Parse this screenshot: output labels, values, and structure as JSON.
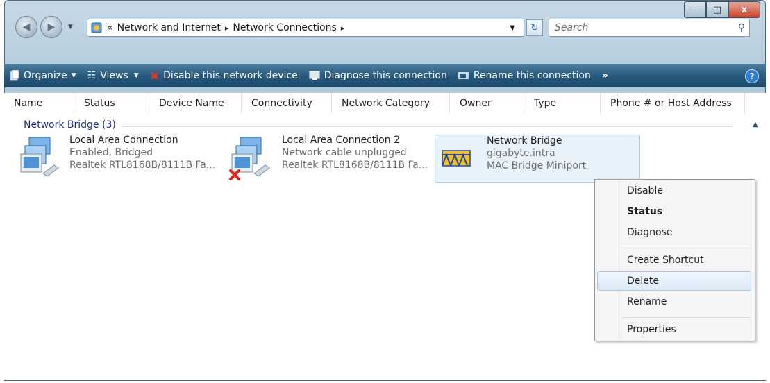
{
  "window": {
    "controls": {
      "minimize": "–",
      "maximize": "□",
      "close": "x"
    }
  },
  "nav": {
    "breadcrumb_prefix": "«",
    "crumbs": [
      "Network and Internet",
      "Network Connections"
    ],
    "separator": "▸",
    "search_placeholder": "Search"
  },
  "toolbar": {
    "items": [
      {
        "label": "Organize",
        "has_dropdown": true
      },
      {
        "label": "Views",
        "has_dropdown": true
      },
      {
        "label": "Disable this network device"
      },
      {
        "label": "Diagnose this connection"
      },
      {
        "label": "Rename this connection"
      }
    ],
    "more": "»",
    "help": "?"
  },
  "columns": [
    "Name",
    "Status",
    "Device Name",
    "Connectivity",
    "Network Category",
    "Owner",
    "Type",
    "Phone # or Host Address"
  ],
  "group": {
    "label": "Network Bridge (3)"
  },
  "items": [
    {
      "name": "Local Area Connection",
      "status": "Enabled, Bridged",
      "device": "Realtek RTL8168B/8111B Fa...",
      "icon": "network-connection-icon",
      "error": false
    },
    {
      "name": "Local Area Connection 2",
      "status": "Network cable unplugged",
      "device": "Realtek RTL8168B/8111B Fa...",
      "icon": "network-connection-icon",
      "error": true
    },
    {
      "name": "Network Bridge",
      "status": "gigabyte.intra",
      "device": "MAC Bridge Miniport",
      "icon": "network-bridge-icon",
      "selected": true
    }
  ],
  "context_menu": {
    "items": [
      "Disable",
      "Status",
      "Diagnose",
      "Create Shortcut",
      "Delete",
      "Rename",
      "Properties"
    ],
    "bold": "Status",
    "highlighted": "Delete"
  },
  "colors": {
    "toolbar": "#285b80",
    "group_label": "#1e3287",
    "selection_bg": "#e8f2fb",
    "selection_border": "#a6cbef"
  }
}
